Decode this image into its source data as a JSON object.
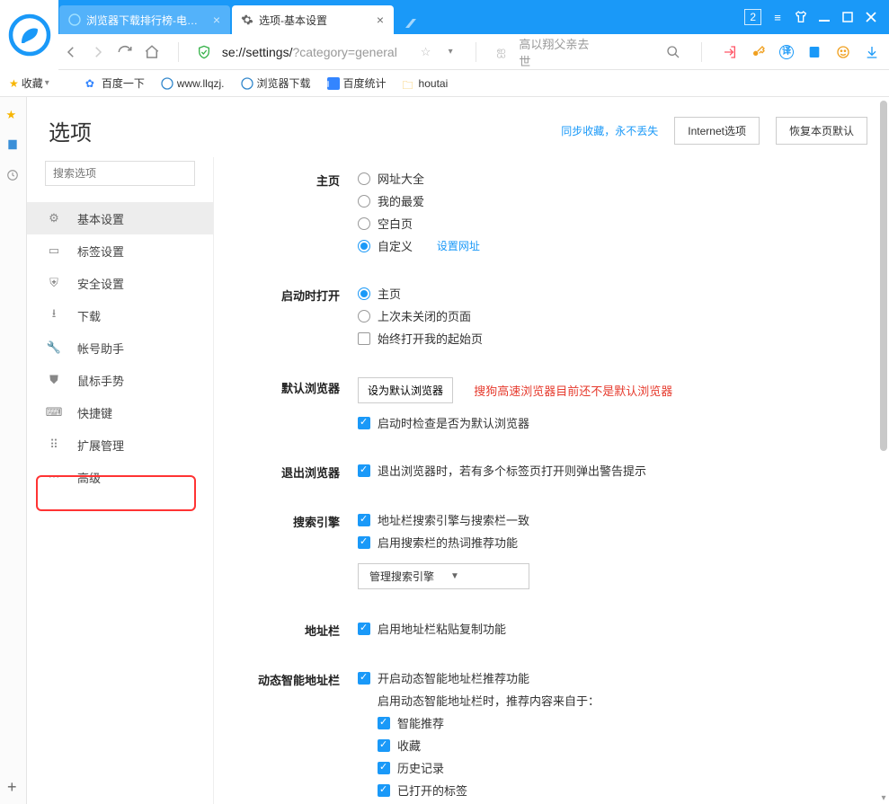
{
  "tabs": [
    {
      "title": "浏览器下载排行榜-电脑…"
    },
    {
      "title": "选项-基本设置"
    }
  ],
  "titlebar": {
    "counter": "2"
  },
  "addressbar": {
    "url_main": "se://settings/",
    "url_query": "?category=general",
    "search_hint": "高以翔父亲去世"
  },
  "bookmarks": {
    "fav_label": "收藏",
    "items": [
      "百度一下",
      "www.llqzj.",
      "浏览器下载",
      "百度统计",
      "houtai"
    ]
  },
  "page": {
    "title": "选项",
    "sync_link": "同步收藏，永不丢失",
    "internet_btn": "Internet选项",
    "restore_btn": "恢复本页默认",
    "search_placeholder": "搜索选项"
  },
  "sidebar": {
    "items": [
      {
        "label": "基本设置",
        "active": true
      },
      {
        "label": "标签设置"
      },
      {
        "label": "安全设置"
      },
      {
        "label": "下载"
      },
      {
        "label": "帐号助手"
      },
      {
        "label": "鼠标手势"
      },
      {
        "label": "快捷键"
      },
      {
        "label": "扩展管理"
      },
      {
        "label": "高级"
      }
    ]
  },
  "settings": {
    "home": {
      "label": "主页",
      "opts": [
        "网址大全",
        "我的最爱",
        "空白页",
        "自定义"
      ],
      "set_url_link": "设置网址"
    },
    "startup": {
      "label": "启动时打开",
      "opts": [
        "主页",
        "上次未关闭的页面"
      ],
      "always_open": "始终打开我的起始页"
    },
    "default_browser": {
      "label": "默认浏览器",
      "btn": "设为默认浏览器",
      "warn": "搜狗高速浏览器目前还不是默认浏览器",
      "check_on_start": "启动时检查是否为默认浏览器"
    },
    "quit": {
      "label": "退出浏览器",
      "text": "退出浏览器时，若有多个标签页打开则弹出警告提示"
    },
    "search": {
      "label": "搜索引擎",
      "opt1": "地址栏搜索引擎与搜索栏一致",
      "opt2": "启用搜索栏的热词推荐功能",
      "manage_btn": "管理搜索引擎"
    },
    "addrbar": {
      "label": "地址栏",
      "opt": "启用地址栏粘贴复制功能"
    },
    "smartaddr": {
      "label": "动态智能地址栏",
      "opt_enable": "开启动态智能地址栏推荐功能",
      "desc": "启用动态智能地址栏时，推荐内容来自于：",
      "subs": [
        "智能推荐",
        "收藏",
        "历史记录",
        "已打开的标签"
      ]
    }
  }
}
